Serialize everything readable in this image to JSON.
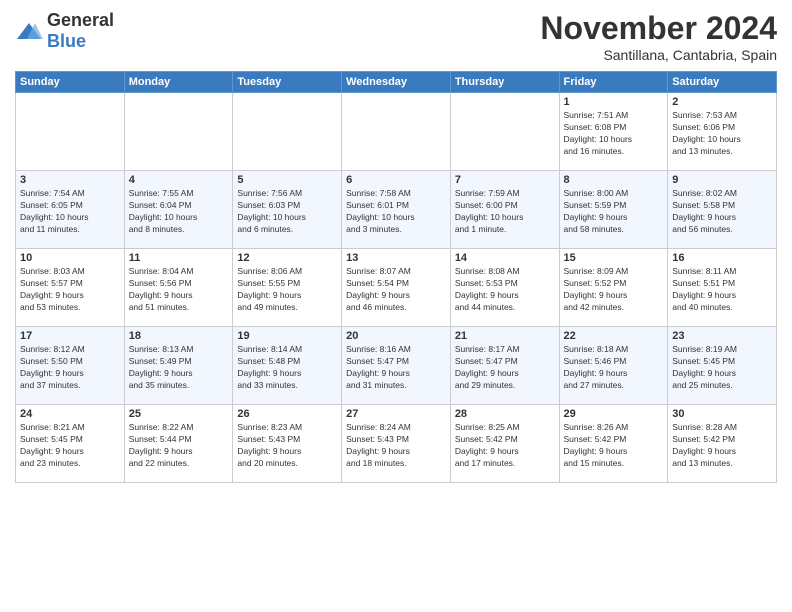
{
  "header": {
    "logo_general": "General",
    "logo_blue": "Blue",
    "month_title": "November 2024",
    "subtitle": "Santillana, Cantabria, Spain"
  },
  "days_of_week": [
    "Sunday",
    "Monday",
    "Tuesday",
    "Wednesday",
    "Thursday",
    "Friday",
    "Saturday"
  ],
  "weeks": [
    [
      {
        "day": "",
        "info": ""
      },
      {
        "day": "",
        "info": ""
      },
      {
        "day": "",
        "info": ""
      },
      {
        "day": "",
        "info": ""
      },
      {
        "day": "",
        "info": ""
      },
      {
        "day": "1",
        "info": "Sunrise: 7:51 AM\nSunset: 6:08 PM\nDaylight: 10 hours\nand 16 minutes."
      },
      {
        "day": "2",
        "info": "Sunrise: 7:53 AM\nSunset: 6:06 PM\nDaylight: 10 hours\nand 13 minutes."
      }
    ],
    [
      {
        "day": "3",
        "info": "Sunrise: 7:54 AM\nSunset: 6:05 PM\nDaylight: 10 hours\nand 11 minutes."
      },
      {
        "day": "4",
        "info": "Sunrise: 7:55 AM\nSunset: 6:04 PM\nDaylight: 10 hours\nand 8 minutes."
      },
      {
        "day": "5",
        "info": "Sunrise: 7:56 AM\nSunset: 6:03 PM\nDaylight: 10 hours\nand 6 minutes."
      },
      {
        "day": "6",
        "info": "Sunrise: 7:58 AM\nSunset: 6:01 PM\nDaylight: 10 hours\nand 3 minutes."
      },
      {
        "day": "7",
        "info": "Sunrise: 7:59 AM\nSunset: 6:00 PM\nDaylight: 10 hours\nand 1 minute."
      },
      {
        "day": "8",
        "info": "Sunrise: 8:00 AM\nSunset: 5:59 PM\nDaylight: 9 hours\nand 58 minutes."
      },
      {
        "day": "9",
        "info": "Sunrise: 8:02 AM\nSunset: 5:58 PM\nDaylight: 9 hours\nand 56 minutes."
      }
    ],
    [
      {
        "day": "10",
        "info": "Sunrise: 8:03 AM\nSunset: 5:57 PM\nDaylight: 9 hours\nand 53 minutes."
      },
      {
        "day": "11",
        "info": "Sunrise: 8:04 AM\nSunset: 5:56 PM\nDaylight: 9 hours\nand 51 minutes."
      },
      {
        "day": "12",
        "info": "Sunrise: 8:06 AM\nSunset: 5:55 PM\nDaylight: 9 hours\nand 49 minutes."
      },
      {
        "day": "13",
        "info": "Sunrise: 8:07 AM\nSunset: 5:54 PM\nDaylight: 9 hours\nand 46 minutes."
      },
      {
        "day": "14",
        "info": "Sunrise: 8:08 AM\nSunset: 5:53 PM\nDaylight: 9 hours\nand 44 minutes."
      },
      {
        "day": "15",
        "info": "Sunrise: 8:09 AM\nSunset: 5:52 PM\nDaylight: 9 hours\nand 42 minutes."
      },
      {
        "day": "16",
        "info": "Sunrise: 8:11 AM\nSunset: 5:51 PM\nDaylight: 9 hours\nand 40 minutes."
      }
    ],
    [
      {
        "day": "17",
        "info": "Sunrise: 8:12 AM\nSunset: 5:50 PM\nDaylight: 9 hours\nand 37 minutes."
      },
      {
        "day": "18",
        "info": "Sunrise: 8:13 AM\nSunset: 5:49 PM\nDaylight: 9 hours\nand 35 minutes."
      },
      {
        "day": "19",
        "info": "Sunrise: 8:14 AM\nSunset: 5:48 PM\nDaylight: 9 hours\nand 33 minutes."
      },
      {
        "day": "20",
        "info": "Sunrise: 8:16 AM\nSunset: 5:47 PM\nDaylight: 9 hours\nand 31 minutes."
      },
      {
        "day": "21",
        "info": "Sunrise: 8:17 AM\nSunset: 5:47 PM\nDaylight: 9 hours\nand 29 minutes."
      },
      {
        "day": "22",
        "info": "Sunrise: 8:18 AM\nSunset: 5:46 PM\nDaylight: 9 hours\nand 27 minutes."
      },
      {
        "day": "23",
        "info": "Sunrise: 8:19 AM\nSunset: 5:45 PM\nDaylight: 9 hours\nand 25 minutes."
      }
    ],
    [
      {
        "day": "24",
        "info": "Sunrise: 8:21 AM\nSunset: 5:45 PM\nDaylight: 9 hours\nand 23 minutes."
      },
      {
        "day": "25",
        "info": "Sunrise: 8:22 AM\nSunset: 5:44 PM\nDaylight: 9 hours\nand 22 minutes."
      },
      {
        "day": "26",
        "info": "Sunrise: 8:23 AM\nSunset: 5:43 PM\nDaylight: 9 hours\nand 20 minutes."
      },
      {
        "day": "27",
        "info": "Sunrise: 8:24 AM\nSunset: 5:43 PM\nDaylight: 9 hours\nand 18 minutes."
      },
      {
        "day": "28",
        "info": "Sunrise: 8:25 AM\nSunset: 5:42 PM\nDaylight: 9 hours\nand 17 minutes."
      },
      {
        "day": "29",
        "info": "Sunrise: 8:26 AM\nSunset: 5:42 PM\nDaylight: 9 hours\nand 15 minutes."
      },
      {
        "day": "30",
        "info": "Sunrise: 8:28 AM\nSunset: 5:42 PM\nDaylight: 9 hours\nand 13 minutes."
      }
    ]
  ]
}
